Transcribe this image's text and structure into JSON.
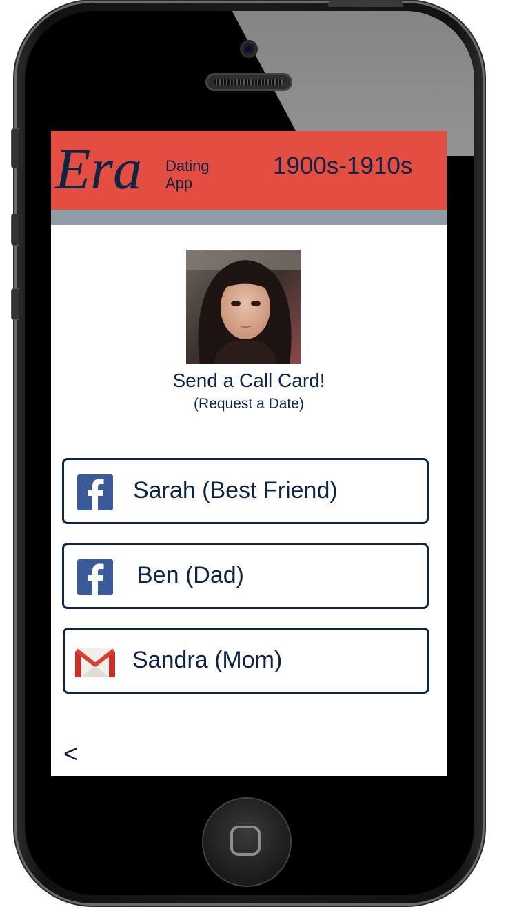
{
  "header": {
    "logo_text": "Era",
    "logo_sub_line1": "Dating",
    "logo_sub_line2": "App",
    "era_range": "1900s-1910s",
    "accent_color": "#e34d42",
    "subbar_color": "#929ca8"
  },
  "profile": {
    "photo_alt": "profile photo",
    "title": "Send a Call Card!",
    "subtitle": "(Request a Date)"
  },
  "contacts": [
    {
      "name": "Sarah (Best Friend)",
      "icon": "facebook-icon"
    },
    {
      "name": "Ben (Dad)",
      "icon": "facebook-icon"
    },
    {
      "name": "Sandra (Mom)",
      "icon": "gmail-icon"
    }
  ],
  "nav": {
    "back_label": "<"
  },
  "colors": {
    "text_navy": "#0f2342",
    "facebook_blue": "#3b5a98"
  }
}
